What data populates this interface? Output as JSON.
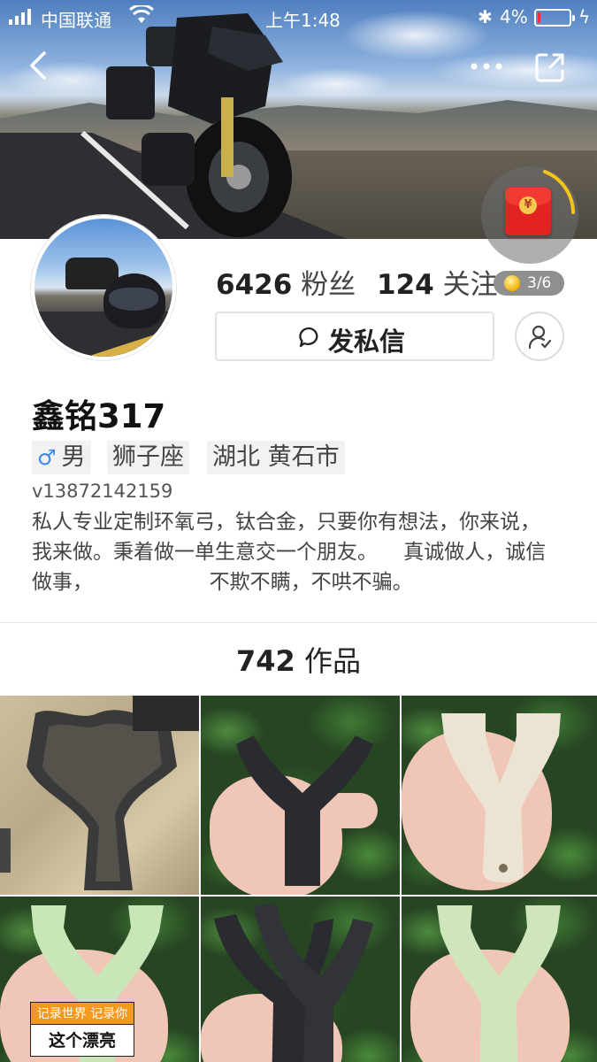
{
  "status_bar": {
    "carrier": "中国联通",
    "time": "上午1:48",
    "battery_percent": "4%",
    "battery_level": 0.04
  },
  "profile": {
    "fans_count": "6426",
    "fans_label": "粉丝",
    "follow_count": "124",
    "follow_label": "关注",
    "coin_progress": "3/6",
    "message_button": "发私信",
    "name": "鑫铭317",
    "tags": {
      "gender": "男",
      "zodiac": "狮子座",
      "location": "湖北 黄石市"
    },
    "uid": "v13872142159",
    "bio_lines": [
      "私人专业定制环氧弓，钛合金，只要你有想法，你来说，",
      "我来做。秉着做一单生意交一个朋友。    真诚做人，诚信",
      "做事，                  不欺不瞒，不哄不骗。"
    ]
  },
  "works": {
    "count": "742",
    "label": "作品",
    "badge_top": "记录世界 记录你",
    "badge_bottom": "这个漂亮"
  },
  "icons": [
    "back-icon",
    "more-icon",
    "share-icon",
    "red-packet-icon",
    "chat-bubble-icon",
    "follow-user-icon",
    "male-icon",
    "coin-icon"
  ],
  "colors": {
    "male": "#3b8be6",
    "red_packet": "#e32222",
    "badge_orange": "#f39a1e",
    "progress_ring": "#f5c518"
  }
}
